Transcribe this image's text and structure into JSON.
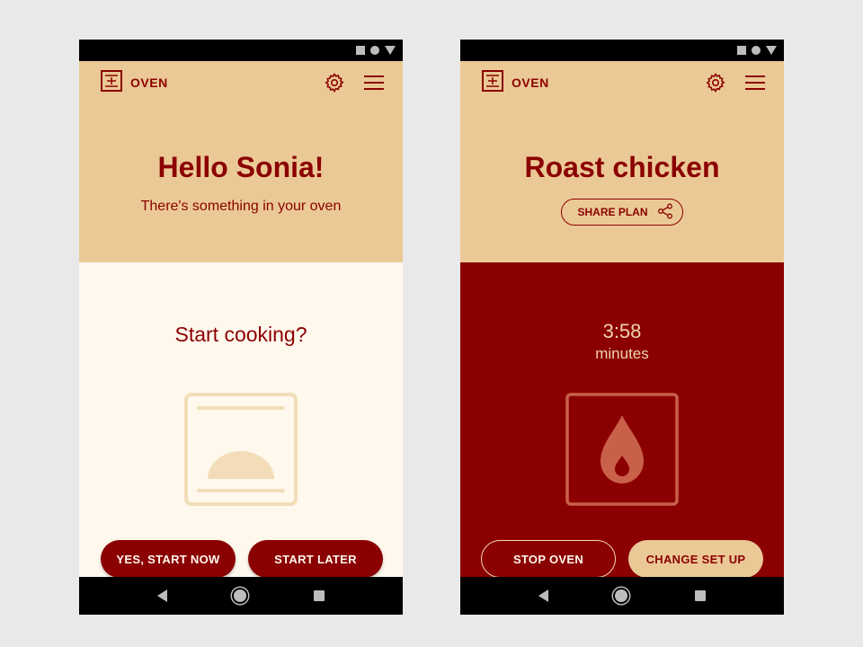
{
  "colors": {
    "primary": "#8b0000",
    "header_bg": "#ebc996",
    "cream_bg": "#fff8ed",
    "light_accent": "#f0d5a8"
  },
  "screens": [
    {
      "app_title": "OVEN",
      "greeting": "Hello Sonia!",
      "subtitle": "There's something in your oven",
      "prompt": "Start cooking?",
      "buttons": {
        "primary": "YES, START NOW",
        "secondary": "START LATER"
      },
      "illustration": "oven-food-icon"
    },
    {
      "app_title": "OVEN",
      "recipe_title": "Roast chicken",
      "share_label": "SHARE PLAN",
      "timer": {
        "value": "3:58",
        "unit": "minutes"
      },
      "buttons": {
        "stop": "STOP OVEN",
        "change": "CHANGE SET UP"
      },
      "illustration": "flame-icon"
    }
  ]
}
